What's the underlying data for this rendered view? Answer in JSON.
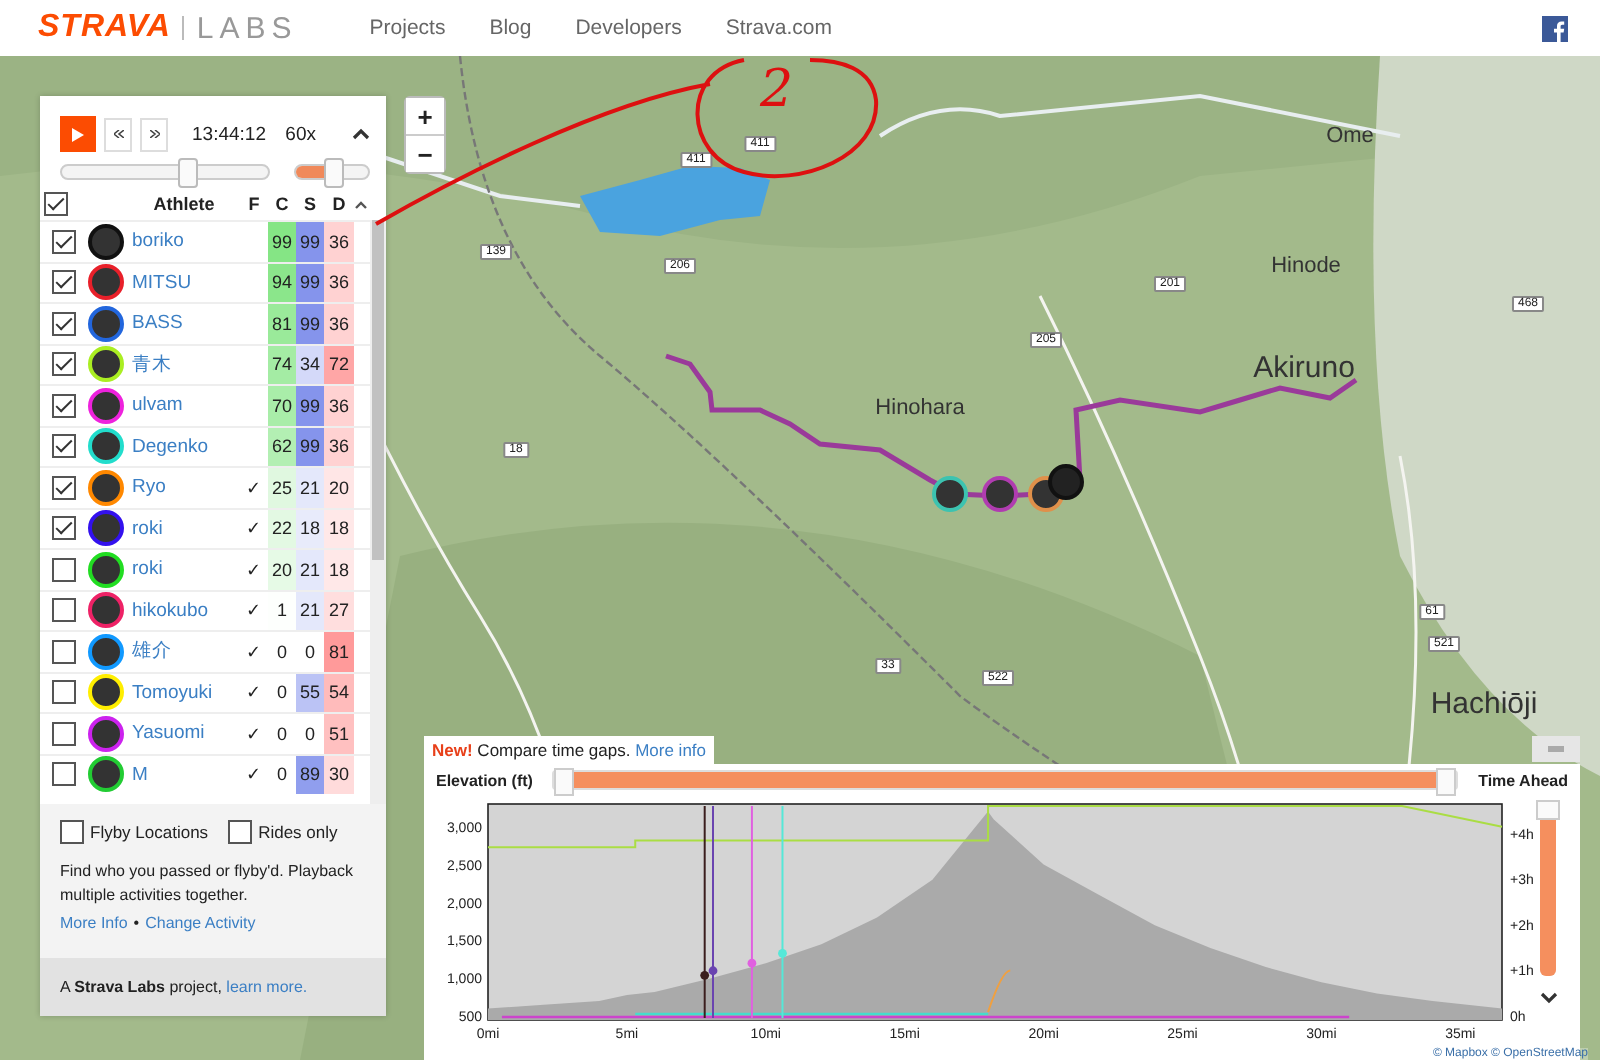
{
  "header": {
    "logo": "STRAVA",
    "logo_suffix": "LABS",
    "nav": [
      "Projects",
      "Blog",
      "Developers",
      "Strava.com"
    ]
  },
  "annotation": {
    "text": "2"
  },
  "map": {
    "zoom_in": "+",
    "zoom_out": "−",
    "labels": [
      {
        "text": "Ome",
        "kind": "place"
      },
      {
        "text": "Hinode",
        "kind": "place"
      },
      {
        "text": "Akiruno",
        "kind": "city"
      },
      {
        "text": "Hinohara",
        "kind": "place"
      },
      {
        "text": "Hachiōji",
        "kind": "city"
      },
      {
        "text": "411",
        "kind": "road"
      },
      {
        "text": "411",
        "kind": "road"
      },
      {
        "text": "139",
        "kind": "road"
      },
      {
        "text": "206",
        "kind": "road"
      },
      {
        "text": "201",
        "kind": "road"
      },
      {
        "text": "205",
        "kind": "road"
      },
      {
        "text": "18",
        "kind": "road"
      },
      {
        "text": "468",
        "kind": "road"
      },
      {
        "text": "61",
        "kind": "road"
      },
      {
        "text": "521",
        "kind": "road"
      },
      {
        "text": "522",
        "kind": "road"
      },
      {
        "text": "33",
        "kind": "road"
      }
    ],
    "attribution": "© Mapbox © OpenStreetMap"
  },
  "playback": {
    "time": "13:44:12",
    "speed": "60x",
    "time_slider": {
      "level": 0.6
    },
    "speed_slider": {
      "level": 0.5
    }
  },
  "athletes": {
    "all_checked": true,
    "columns": [
      "Athlete",
      "F",
      "C",
      "S",
      "D"
    ],
    "flyby_mark": "✓",
    "rows": [
      {
        "name": "boriko",
        "checked": true,
        "color": "#111111",
        "flyby": false,
        "c": "99",
        "s": "99",
        "d": "36"
      },
      {
        "name": "MITSU",
        "checked": true,
        "color": "#e8202a",
        "flyby": false,
        "c": "94",
        "s": "99",
        "d": "36"
      },
      {
        "name": "BASS",
        "checked": true,
        "color": "#2266dd",
        "flyby": false,
        "c": "81",
        "s": "99",
        "d": "36"
      },
      {
        "name": "青木",
        "checked": true,
        "color": "#aaee22",
        "flyby": false,
        "c": "74",
        "s": "34",
        "d": "72"
      },
      {
        "name": "ulvam",
        "checked": true,
        "color": "#ee22dd",
        "flyby": false,
        "c": "70",
        "s": "99",
        "d": "36"
      },
      {
        "name": "Degenko",
        "checked": true,
        "color": "#22ddcc",
        "flyby": false,
        "c": "62",
        "s": "99",
        "d": "36"
      },
      {
        "name": "Ryo",
        "checked": true,
        "color": "#ff8800",
        "flyby": true,
        "c": "25",
        "s": "21",
        "d": "20"
      },
      {
        "name": "roki",
        "checked": true,
        "color": "#3311ee",
        "flyby": true,
        "c": "22",
        "s": "18",
        "d": "18"
      },
      {
        "name": "roki",
        "checked": false,
        "color": "#22dd22",
        "flyby": true,
        "c": "20",
        "s": "21",
        "d": "18"
      },
      {
        "name": "hikokubo",
        "checked": false,
        "color": "#ee2266",
        "flyby": true,
        "c": "1",
        "s": "21",
        "d": "27"
      },
      {
        "name": "雄介",
        "checked": false,
        "color": "#1199ff",
        "flyby": true,
        "c": "0",
        "s": "0",
        "d": "81"
      },
      {
        "name": "Tomoyuki",
        "checked": false,
        "color": "#ffee00",
        "flyby": true,
        "c": "0",
        "s": "55",
        "d": "54"
      },
      {
        "name": "Yasuomi",
        "checked": false,
        "color": "#cc22ee",
        "flyby": true,
        "c": "0",
        "s": "0",
        "d": "51"
      },
      {
        "name": "M",
        "checked": false,
        "color": "#22cc33",
        "flyby": true,
        "c": "0",
        "s": "89",
        "d": "30"
      }
    ]
  },
  "options": [
    {
      "label": "Flyby Locations",
      "checked": false
    },
    {
      "label": "Rides only",
      "checked": false
    }
  ],
  "description": "Find who you passed or flyby'd. Playback multiple activities together.",
  "links": [
    "More Info",
    "Change Activity"
  ],
  "link_separator": "•",
  "footer": {
    "text": "A **Strava Labs** project,",
    "link": "learn more."
  },
  "chart_panel": {
    "badge": "New!",
    "message": "Compare time gaps.",
    "link": "More info",
    "range_slider": {
      "level": 1
    },
    "right_label": "Time Ahead",
    "right_ticks": [
      "+4h",
      "+3h",
      "+2h",
      "+1h",
      "0h"
    ],
    "side_slider": {
      "level": 1
    },
    "chart_data": {
      "type": "area",
      "ylabel": "Elevation (ft)",
      "x": [
        0,
        2,
        4,
        5,
        6,
        8,
        10,
        12,
        14,
        16,
        18,
        18.2,
        20,
        22,
        24,
        26,
        28,
        30,
        32,
        34,
        36.5
      ],
      "series": [
        {
          "color": "#aaaaaa",
          "values": [
            600,
            650,
            700,
            780,
            820,
            1000,
            1200,
            1450,
            1800,
            2300,
            3200,
            3100,
            2500,
            2100,
            1700,
            1400,
            1150,
            950,
            800,
            700,
            600
          ]
        }
      ],
      "xlim": [
        0,
        36.5
      ],
      "ylim": [
        450,
        3300
      ],
      "xticks": [
        {
          "value": 0,
          "label": "0mi"
        },
        {
          "value": 5,
          "label": "5mi"
        },
        {
          "value": 10,
          "label": "10mi"
        },
        {
          "value": 15,
          "label": "15mi"
        },
        {
          "value": 20,
          "label": "20mi"
        },
        {
          "value": 25,
          "label": "25mi"
        },
        {
          "value": 30,
          "label": "30mi"
        },
        {
          "value": 35,
          "label": "35mi"
        }
      ],
      "yticks": [
        {
          "value": 500,
          "label": "500"
        },
        {
          "value": 1000,
          "label": "1,000"
        },
        {
          "value": 1500,
          "label": "1,500"
        },
        {
          "value": 2000,
          "label": "2,000"
        },
        {
          "value": 2500,
          "label": "2,500"
        },
        {
          "value": 3000,
          "label": "3,000"
        }
      ]
    }
  }
}
